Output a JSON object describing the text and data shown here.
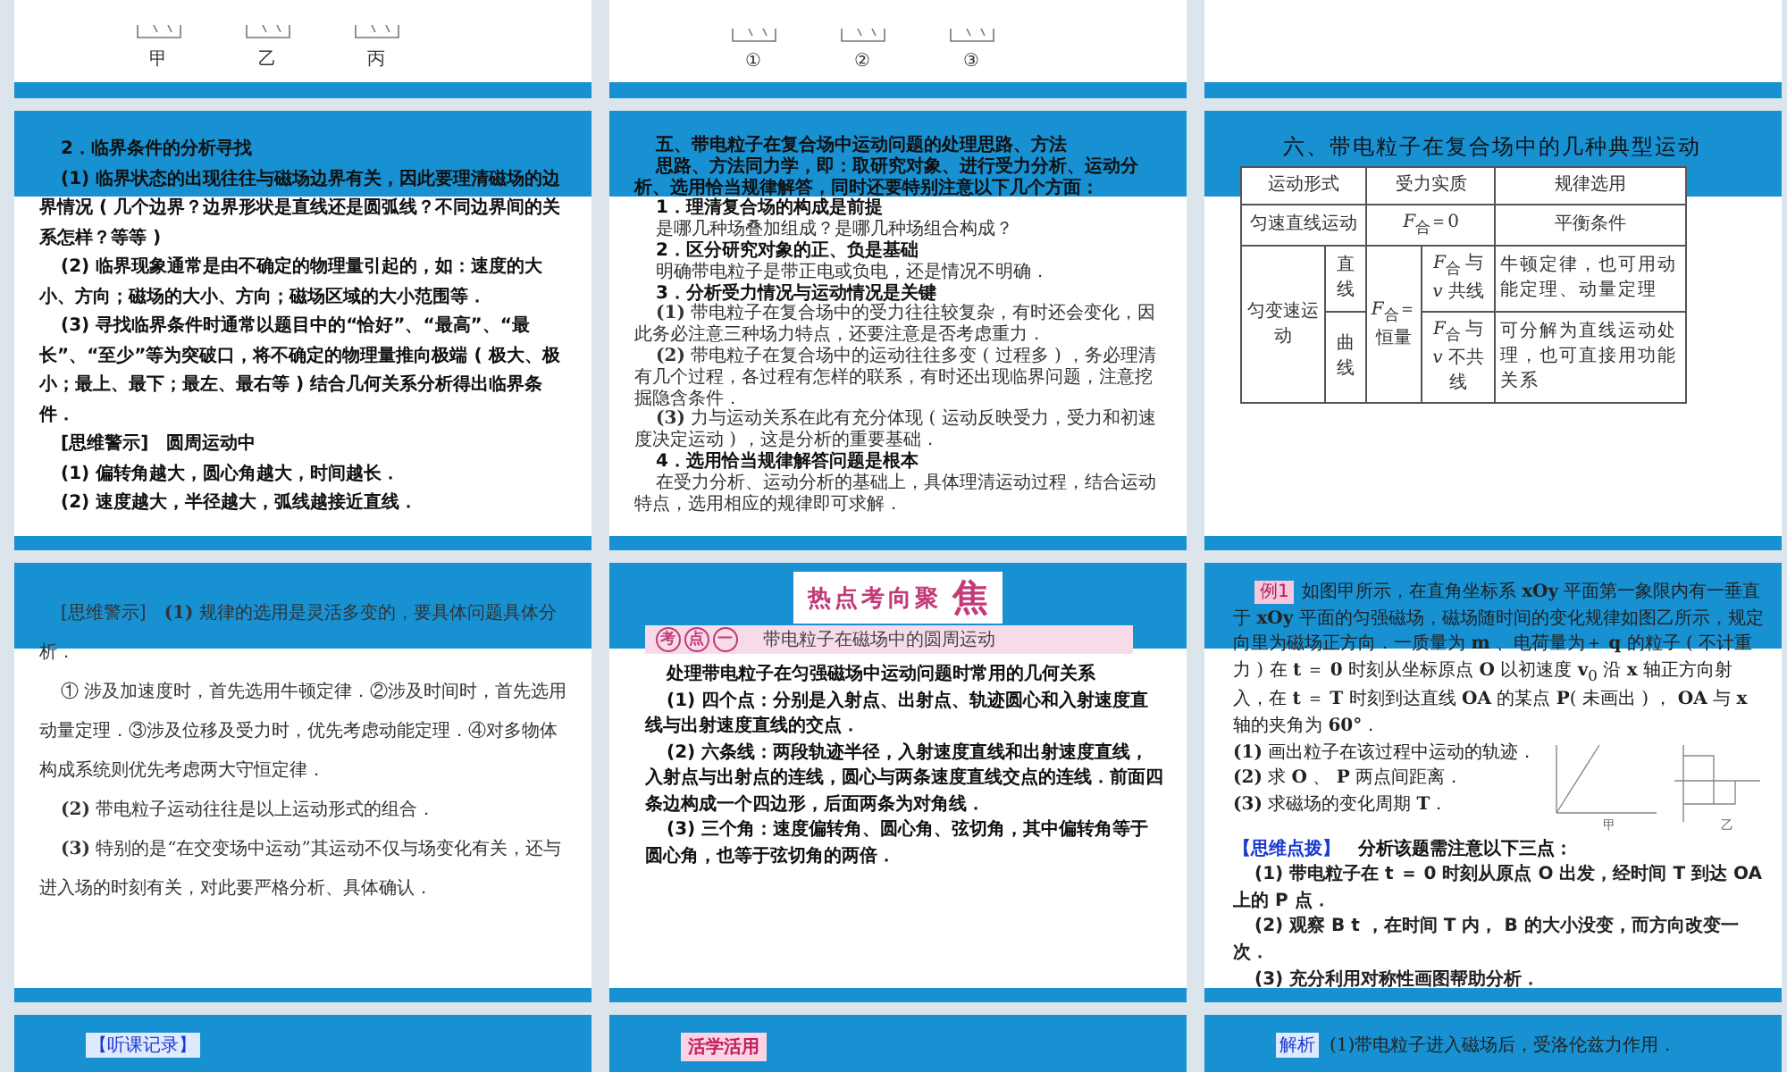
{
  "slides": [
    {
      "kind": "figure_tail",
      "labels": [
        "甲",
        "乙",
        "丙"
      ]
    },
    {
      "kind": "figure_tail",
      "labels": [
        "①",
        "②",
        "③"
      ]
    },
    {
      "kind": "blank_tail"
    },
    {
      "kind": "text",
      "paragraphs": [
        {
          "kind": "heading",
          "text": "2．临界条件的分析寻找"
        },
        {
          "kind": "bold",
          "text": "(1) 临界状态的出现往往与磁场边界有关，因此要理清磁场的边界情况 ( 几个边界？边界形状是直线还是圆弧线？不同边界间的关系怎样？等等 )"
        },
        {
          "kind": "bold",
          "text": "(2) 临界现象通常是由不确定的物理量引起的，如：速度的大小、方向；磁场的大小、方向；磁场区域的大小范围等．"
        },
        {
          "kind": "bold",
          "text": "(3) 寻找临界条件时通常以题目中的“恰好”、“最高”、“最长”、“至少”等为突破口，将不确定的物理量推向极端 ( 极大、极小；最上、最下；最左、最右等 ) 结合几何关系分析得出临界条件．"
        },
        {
          "kind": "bold",
          "text": "[思维警示]　圆周运动中"
        },
        {
          "kind": "bold",
          "text": "(1) 偏转角越大，圆心角越大，时间越长．"
        },
        {
          "kind": "bold",
          "text": "(2) 速度越大，半径越大，弧线越接近直线．"
        }
      ]
    },
    {
      "kind": "text",
      "paragraphs": [
        {
          "kind": "heading",
          "text": "五、带电粒子在复合场中运动问题的处理思路、方法"
        },
        {
          "kind": "heading",
          "text": "思路、方法同力学，即：取研究对象、进行受力分析、运动分析、选用恰当规律解答，同时还要特别注意以下几个方面："
        },
        {
          "kind": "heading",
          "text": "1．理清复合场的构成是前提"
        },
        {
          "kind": "text",
          "text": "是哪几种场叠加组成？是哪几种场组合构成？"
        },
        {
          "kind": "heading",
          "text": "2．区分研究对象的正、负是基础"
        },
        {
          "kind": "text",
          "text": "明确带电粒子是带正电或负电，还是情况不明确．"
        },
        {
          "kind": "heading",
          "text": "3．分析受力情况与运动情况是关键"
        },
        {
          "kind": "text",
          "text": "**(1)** 带电粒子在复合场中的受力往往较复杂，有时还会变化，因此务必注意三种场力特点，还要注意是否考虑重力．"
        },
        {
          "kind": "text",
          "text": "**(2)** 带电粒子在复合场中的运动往往多变 ( 过程多 ) ，务必理清有几个过程，各过程有怎样的联系，有时还出现临界问题，注意挖掘隐含条件．"
        },
        {
          "kind": "text",
          "text": "**(3)** 力与运动关系在此有充分体现 ( 运动反映受力，受力和初速度决定运动 ) ，这是分析的重要基础．"
        },
        {
          "kind": "heading",
          "text": "4．选用恰当规律解答问题是根本"
        },
        {
          "kind": "text",
          "text": "在受力分析、运动分析的基础上，具体理清运动过程，结合运动特点，选用相应的规律即可求解．"
        }
      ]
    },
    {
      "kind": "table",
      "title": "六、带电粒子在复合场中的几种典型运动",
      "rows": [
        [
          {
            "text": "运动形式",
            "colspan": 2
          },
          {
            "text": "受力实质",
            "colspan": 2
          },
          {
            "text": "规律选用"
          }
        ],
        [
          {
            "text": "匀速直线运动",
            "colspan": 2
          },
          {
            "text": "*F*$_{合}$＝0",
            "colspan": 2
          },
          {
            "text": "平衡条件"
          }
        ],
        [
          {
            "text": "匀变速运动",
            "rowspan": 2
          },
          {
            "text": "直线"
          },
          {
            "text": "*F*$_{合}$＝恒量",
            "rowspan": 2
          },
          {
            "text": "*F*$_{合}$ 与 *v* 共线"
          },
          {
            "text": "牛顿定律，也可用动能定理、动量定理"
          }
        ],
        [
          {
            "text": "曲线"
          },
          {
            "text": "*F*$_{合}$ 与 *v* 不共线"
          },
          {
            "text": "可分解为直线运动处理，也可直接用功能关系"
          }
        ]
      ]
    },
    {
      "kind": "text",
      "paragraphs": [
        {
          "kind": "text",
          "text": "[思维警示]　**(1)** 规律的选用是灵活多变的，要具体问题具体分析．"
        },
        {
          "kind": "text",
          "text": "① 涉及加速度时，首先选用牛顿定律．②涉及时间时，首先选用动量定理．③涉及位移及受力时，优先考虑动能定理．④对多物体构成系统则优先考虑两大守恒定律．"
        },
        {
          "kind": "text",
          "text": "**(2)** 带电粒子运动往往是以上运动形式的组合．"
        },
        {
          "kind": "text",
          "text": "**(3)** 特别的是“在交变场中运动”其运动不仅与场变化有关，还与进入场的时刻有关，对此要严格分析、具体确认．"
        }
      ]
    },
    {
      "kind": "banner",
      "banner": "热点考向聚",
      "banner_mark": "焦",
      "topic_tags": [
        "考",
        "点",
        "一"
      ],
      "topic": "带电粒子在磁场中的圆周运动",
      "paragraphs": [
        {
          "kind": "bold",
          "text": "处理带电粒子在匀强磁场中运动问题时常用的几何关系"
        },
        {
          "kind": "bold",
          "text": "(1) 四个点：分别是入射点、出射点、轨迹圆心和入射速度直线与出射速度直线的交点．"
        },
        {
          "kind": "bold",
          "text": "(2) 六条线：两段轨迹半径，入射速度直线和出射速度直线，入射点与出射点的连线，圆心与两条速度直线交点的连线．前面四条边构成一个四边形，后面两条为对角线．"
        },
        {
          "kind": "bold",
          "text": "(3) 三个角：速度偏转角、圆心角、弦切角，其中偏转角等于圆心角，也等于弦切角的两倍．"
        }
      ]
    },
    {
      "kind": "example",
      "badge": "例1",
      "intro": "如图甲所示，在直角坐标系 **xOy** 平面第一象限内有一垂直于 **xOy** 平面的匀强磁场，磁场随时间的变化规律如图乙所示，规定向里为磁场正方向．一质量为 **m** 、电荷量为＋ **q** 的粒子 ( 不计重力 ) 在 **t** ＝ **0** 时刻从坐标原点 **O** 以初速度 **v**$_{0}$ 沿 **x** 轴正方向射入，在 **t** ＝ **T** 时刻到达直线 **OA** 的某点 **P**( 未画出 ) ， **OA** 与 **x** 轴的夹角为 **60°**．",
      "figure_labels": [
        "甲",
        "乙"
      ],
      "questions": [
        "**(1)** 画出粒子在该过程中运动的轨迹．",
        "**(2)** 求 **O** 、 **P** 两点间距离．",
        "**(3)** 求磁场的变化周期 **T**．"
      ],
      "tip_label": "【思维点拨】",
      "tip": "分析该题需注意以下三点：",
      "points": [
        "(1) 带电粒子在 t ＝ 0 时刻从原点 O 出发，经时间 T 到达 OA 上的 P 点．",
        "(2) 观察 B t ，在时间 T 内， B 的大小没变，而方向改变一次．",
        "(3) 充分利用对称性画图帮助分析．"
      ]
    },
    {
      "kind": "tail",
      "label": "【听课记录】"
    },
    {
      "kind": "tail_badge",
      "badge": "活学活用"
    },
    {
      "kind": "tail",
      "label": "解析",
      "text": "(1)带电粒子进入磁场后，受洛伦兹力作用．"
    }
  ]
}
